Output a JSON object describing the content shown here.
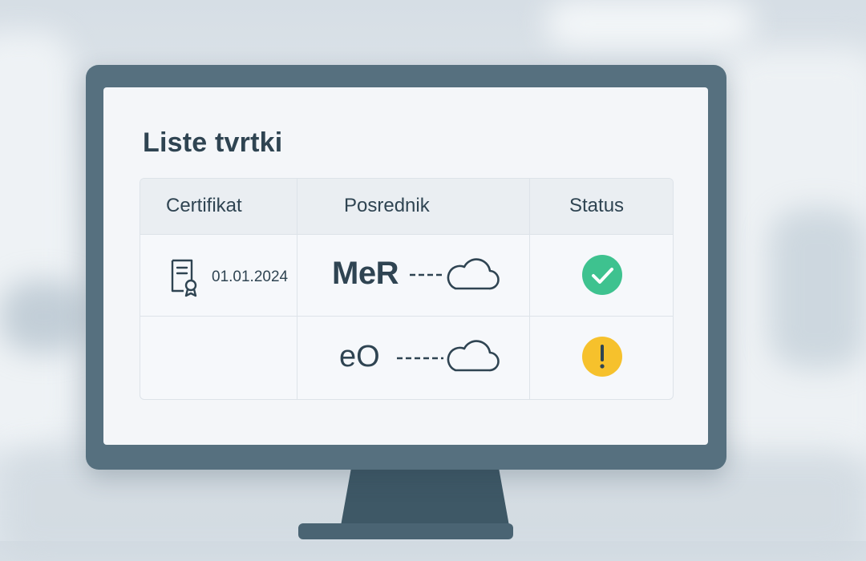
{
  "window": {
    "title": "Liste tvrtki"
  },
  "table": {
    "headers": [
      "Certifikat",
      "Posrednik",
      "Status"
    ],
    "rows": [
      {
        "certificate_date": "01.01.2024",
        "intermediary": "MeR",
        "status": "ok"
      },
      {
        "certificate_date": "",
        "intermediary": "eO",
        "status": "warning"
      }
    ]
  },
  "icons": {
    "certificate": "certificate-icon",
    "cloud": "cloud-icon",
    "ok": "check-circle-icon",
    "warning": "exclamation-circle-icon"
  },
  "colors": {
    "text": "#2f4452",
    "ok": "#3ec28f",
    "warning": "#f6c12c",
    "monitor": "#56707f"
  }
}
